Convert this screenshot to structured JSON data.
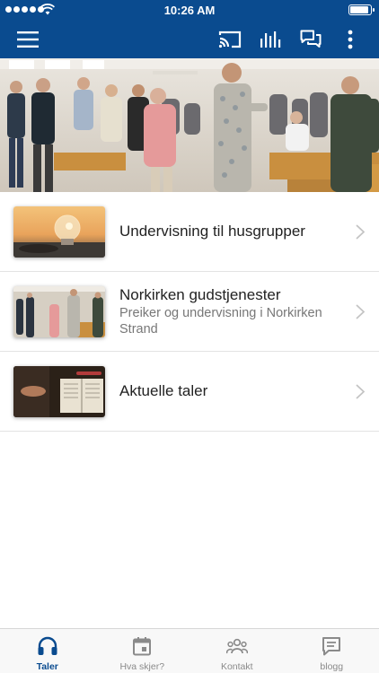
{
  "status_bar": {
    "time": "10:26 AM"
  },
  "app_bar": {
    "icons": [
      "menu-icon",
      "cast-icon",
      "equalizer-icon",
      "chat-icon",
      "more-icon"
    ]
  },
  "colors": {
    "primary": "#0a4b8f",
    "tab_inactive": "#8a8a8a",
    "text": "#222222",
    "subtext": "#777777"
  },
  "list": {
    "items": [
      {
        "title": "Undervisning til husgrupper",
        "subtitle": ""
      },
      {
        "title": "Norkirken gudstjenester",
        "subtitle": "Preiker og undervisning i Norkirken Strand"
      },
      {
        "title": "Aktuelle taler",
        "subtitle": ""
      }
    ]
  },
  "tab_bar": {
    "tabs": [
      {
        "label": "Taler",
        "icon": "headphones-icon",
        "active": true
      },
      {
        "label": "Hva skjer?",
        "icon": "calendar-icon",
        "active": false
      },
      {
        "label": "Kontakt",
        "icon": "people-icon",
        "active": false
      },
      {
        "label": "blogg",
        "icon": "message-icon",
        "active": false
      }
    ]
  }
}
